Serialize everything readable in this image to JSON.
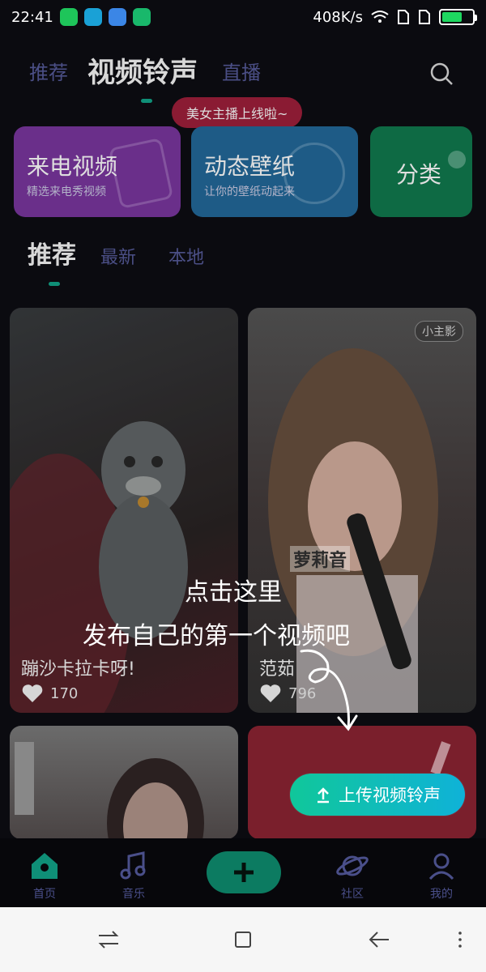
{
  "status_bar": {
    "time": "22:41",
    "speed": "408K/s"
  },
  "top_nav": {
    "tabs": [
      {
        "label": "推荐"
      },
      {
        "label": "视频铃声"
      },
      {
        "label": "直播"
      }
    ],
    "active_index": 1
  },
  "live_pill": {
    "text": "美女主播上线啦~"
  },
  "feature_cards": [
    {
      "title": "来电视频",
      "subtitle": "精选来电秀视频",
      "color": "#7b3a9c"
    },
    {
      "title": "动态壁纸",
      "subtitle": "让你的壁纸动起来",
      "color": "#1f5f8f"
    },
    {
      "title": "分类",
      "subtitle": "",
      "color": "#0f6b44"
    }
  ],
  "section_tabs": [
    {
      "label": "推荐"
    },
    {
      "label": "最新"
    },
    {
      "label": "本地"
    }
  ],
  "videos": [
    {
      "title": "蹦沙卡拉卡呀!",
      "likes": "170",
      "badge": ""
    },
    {
      "title": "范茹",
      "likes": "796",
      "badge": "小主影"
    },
    {
      "title": "",
      "likes": "",
      "badge": ""
    },
    {
      "title": "",
      "likes": "",
      "badge": ""
    }
  ],
  "overlay_hint": {
    "line1": "点击这里",
    "line2": "发布自己的第一个视频吧"
  },
  "video_caption_text": "萝莉音",
  "upload_button": {
    "label": "上传视频铃声"
  },
  "bottom_nav": [
    {
      "label": "首页",
      "icon": "home-icon"
    },
    {
      "label": "音乐",
      "icon": "music-icon"
    },
    {
      "label": "",
      "icon": "plus-icon"
    },
    {
      "label": "社区",
      "icon": "planet-icon"
    },
    {
      "label": "我的",
      "icon": "user-icon"
    }
  ],
  "colors": {
    "accent": "#0f8f77",
    "background": "#0b0b10",
    "upload_gradient_start": "#10c79a",
    "upload_gradient_end": "#0fb2d8"
  }
}
